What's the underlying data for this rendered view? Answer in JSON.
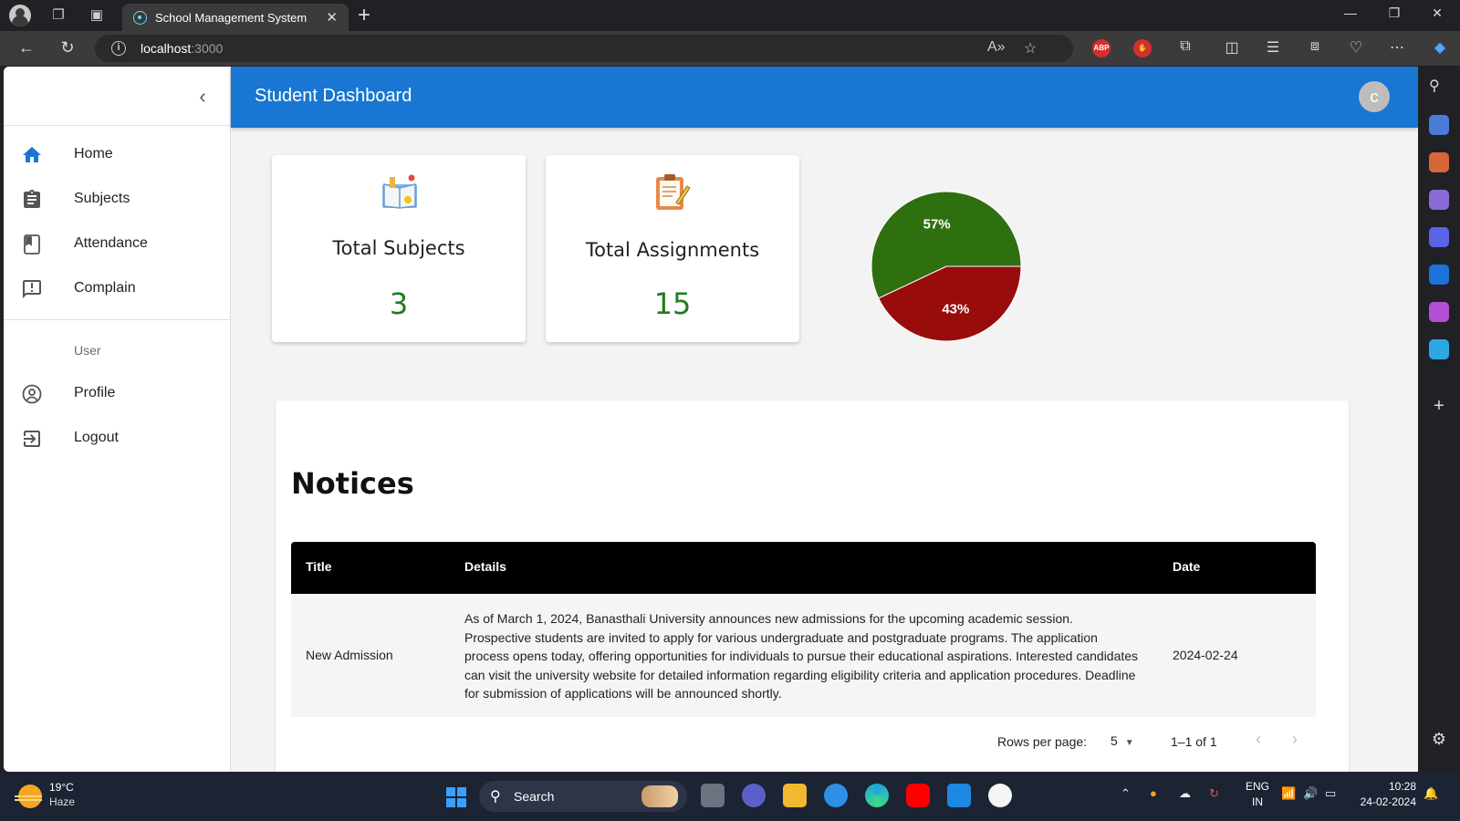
{
  "browser": {
    "tab_title": "School Management System",
    "url_host": "localhost",
    "url_port": ":3000",
    "extension_abp": "ABP"
  },
  "app": {
    "header_title": "Student Dashboard",
    "avatar_letter": "c",
    "colors": {
      "primary": "#1976d2",
      "value_green": "#1e7d1e",
      "pie_green": "#2e6f0f",
      "pie_red": "#990c0c"
    }
  },
  "sidebar": {
    "items": [
      {
        "label": "Home",
        "icon": "home-icon"
      },
      {
        "label": "Subjects",
        "icon": "assignment-icon"
      },
      {
        "label": "Attendance",
        "icon": "bookmark-icon"
      },
      {
        "label": "Complain",
        "icon": "announcement-icon"
      }
    ],
    "section_label": "User",
    "user_items": [
      {
        "label": "Profile",
        "icon": "account-circle-icon"
      },
      {
        "label": "Logout",
        "icon": "exit-icon"
      }
    ]
  },
  "stats": {
    "subjects_label": "Total Subjects",
    "subjects_value": "3",
    "assignments_label": "Total Assignments",
    "assignments_value": "15"
  },
  "chart_data": {
    "type": "pie",
    "slices": [
      {
        "label": "57%",
        "value": 57,
        "color": "#2e6f0f"
      },
      {
        "label": "43%",
        "value": 43,
        "color": "#990c0c"
      }
    ]
  },
  "notices": {
    "heading": "Notices",
    "columns": [
      "Title",
      "Details",
      "Date"
    ],
    "rows": [
      {
        "title": "New Admission",
        "details": "As of March 1, 2024, Banasthali University announces new admissions for the upcoming academic session. Prospective students are invited to apply for various undergraduate and postgraduate programs. The application process opens today, offering opportunities for individuals to pursue their educational aspirations. Interested candidates can visit the university website for detailed information regarding eligibility criteria and application procedures. Deadline for submission of applications will be announced shortly.",
        "date": "2024-02-24"
      }
    ],
    "rows_per_page_label": "Rows per page:",
    "rows_per_page_value": "5",
    "range": "1–1 of 1"
  },
  "taskbar": {
    "temperature": "19°C",
    "weather": "Haze",
    "search_label": "Search",
    "lang_top": "ENG",
    "lang_bottom": "IN",
    "time": "10:28",
    "date": "24-02-2024"
  }
}
